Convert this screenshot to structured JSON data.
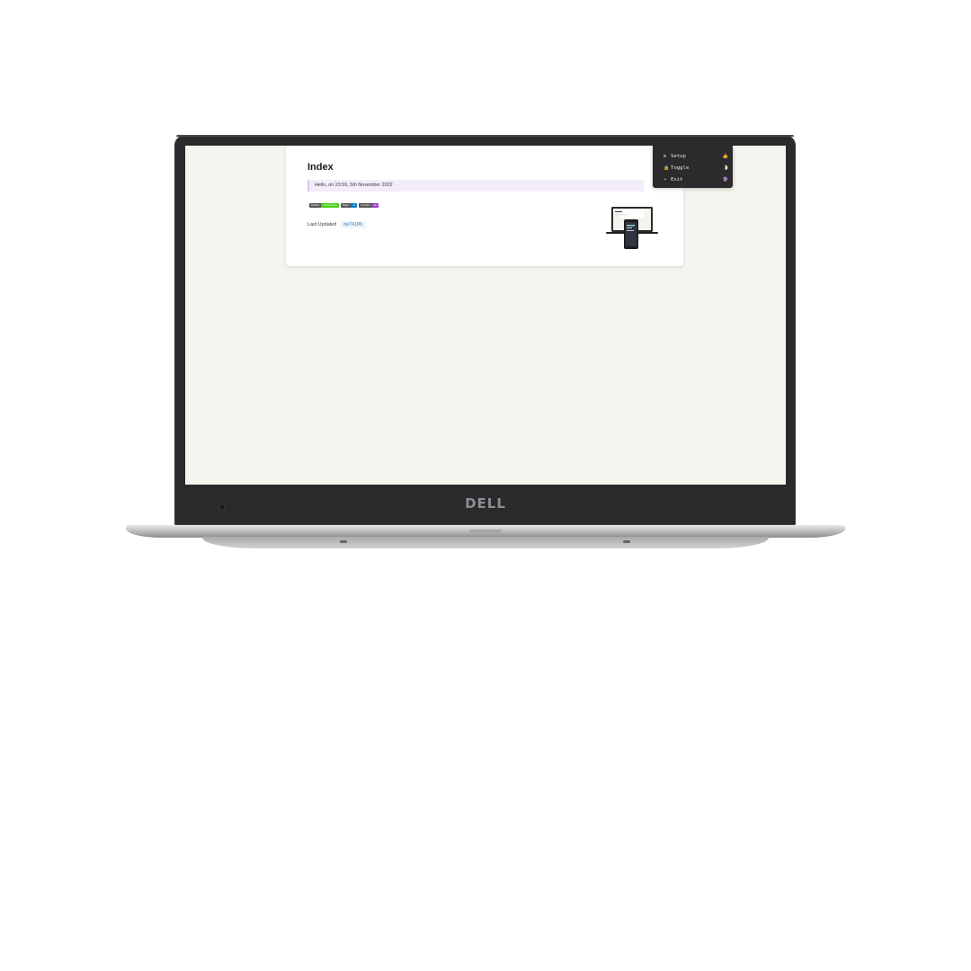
{
  "device": {
    "brand": "DELL"
  },
  "page": {
    "title": "Index",
    "greeting": "Hello, on 23:59, 5th November 2022",
    "badges": [
      {
        "key": "Website",
        "value": "online/update",
        "color": "#44cc11"
      },
      {
        "key": "Pages",
        "value": "v4",
        "color": "#007ec6"
      },
      {
        "key": "Commits",
        "value": "dev",
        "color": "#9b3bc2"
      }
    ],
    "last_updated_label": "Last Updated",
    "commit_hash": "de74106"
  },
  "menu": {
    "items": [
      {
        "icon": "⚙",
        "label": "Setup",
        "emoji": "👍"
      },
      {
        "icon": "🔒",
        "label": "Toggle",
        "emoji": "🌓"
      },
      {
        "icon": "➔",
        "label": "Exit",
        "emoji": "🔮"
      }
    ]
  }
}
